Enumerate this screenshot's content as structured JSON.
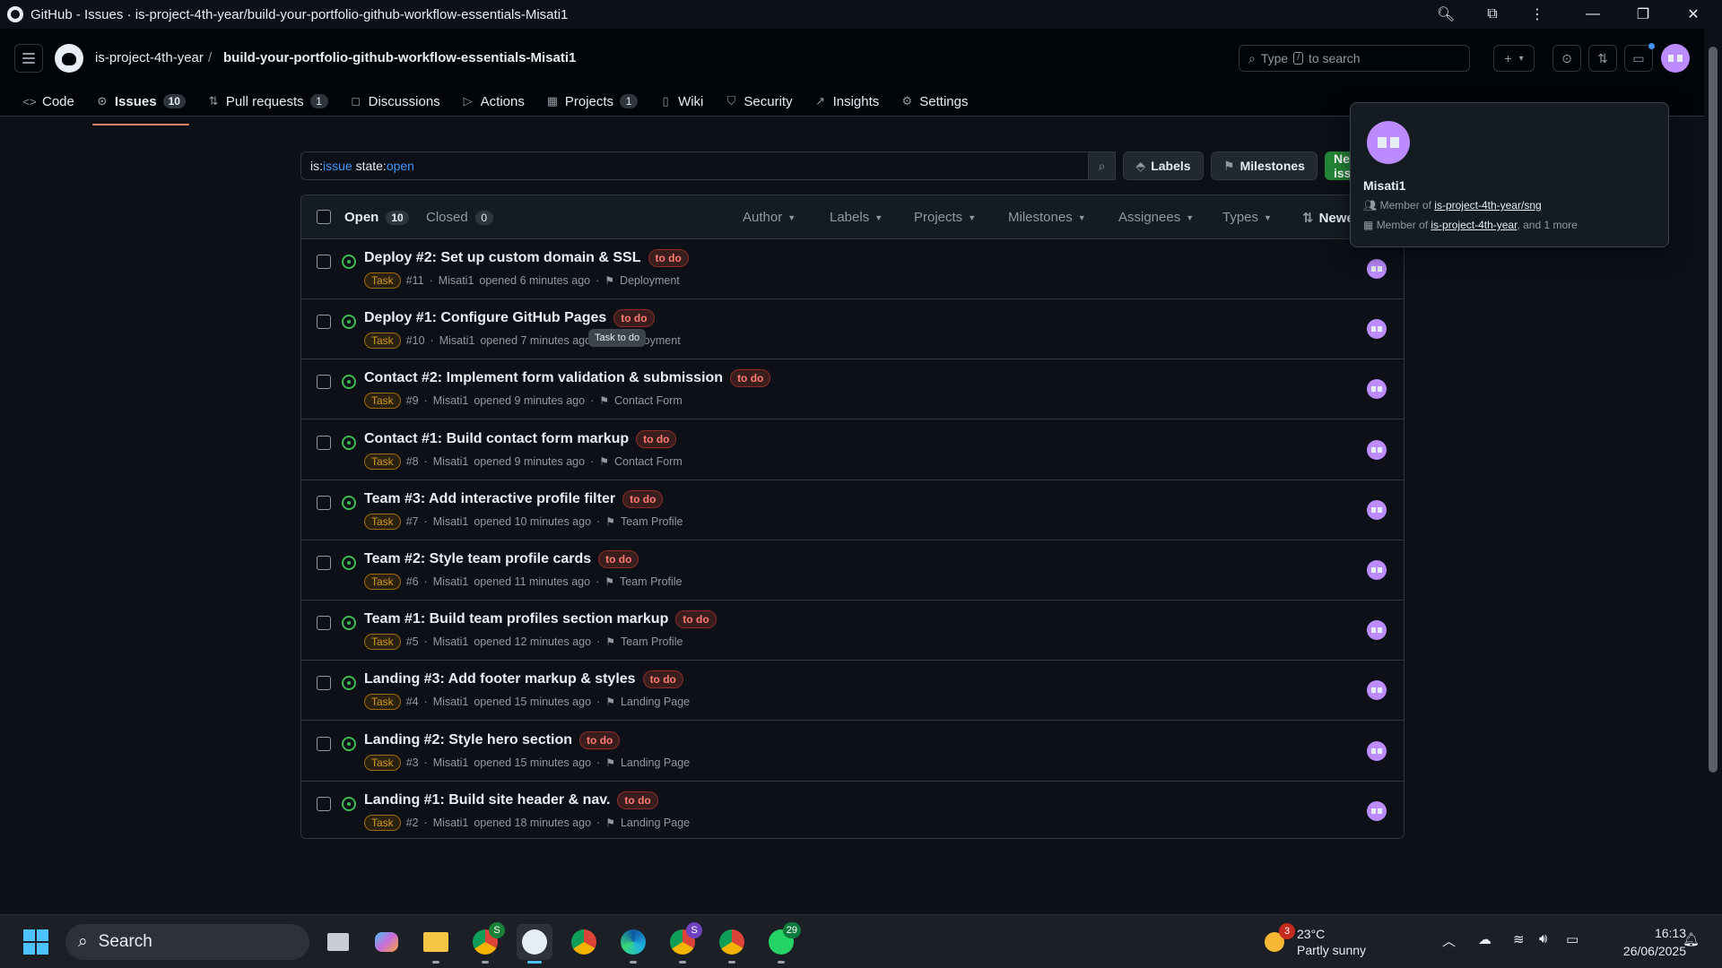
{
  "window": {
    "title": "GitHub - Issues · is-project-4th-year/build-your-portfolio-github-workflow-essentials-Misati1"
  },
  "header": {
    "owner": "is-project-4th-year",
    "separator": "/",
    "repo": "build-your-portfolio-github-workflow-essentials-Misati1",
    "search_prefix": "Type",
    "search_key": "/",
    "search_suffix": "to search",
    "plus_label": "+",
    "caret": "▾"
  },
  "repo_nav": [
    {
      "label": "Code",
      "icon": "code-icon",
      "glyph": "<>",
      "count": ""
    },
    {
      "label": "Issues",
      "icon": "issue-icon",
      "glyph": "⊙",
      "count": "10",
      "active": true
    },
    {
      "label": "Pull requests",
      "icon": "pull-request-icon",
      "glyph": "⇅",
      "count": "1"
    },
    {
      "label": "Discussions",
      "icon": "discussions-icon",
      "glyph": "◻",
      "count": ""
    },
    {
      "label": "Actions",
      "icon": "actions-icon",
      "glyph": "▷",
      "count": ""
    },
    {
      "label": "Projects",
      "icon": "projects-icon",
      "glyph": "▦",
      "count": "1"
    },
    {
      "label": "Wiki",
      "icon": "book-icon",
      "glyph": "▯",
      "count": ""
    },
    {
      "label": "Security",
      "icon": "shield-icon",
      "glyph": "⛉",
      "count": ""
    },
    {
      "label": "Insights",
      "icon": "graph-icon",
      "glyph": "↗",
      "count": ""
    },
    {
      "label": "Settings",
      "icon": "gear-icon",
      "glyph": "⚙",
      "count": ""
    }
  ],
  "filter": {
    "k1": "is:",
    "v1": "issue",
    "k2": " state:",
    "v2": "open"
  },
  "buttons": {
    "labels": "Labels",
    "milestones": "Milestones",
    "new_issue": "New issue"
  },
  "list_header": {
    "open_label": "Open",
    "open_count": "10",
    "closed_label": "Closed",
    "closed_count": "0",
    "filters": [
      "Author",
      "Labels",
      "Projects",
      "Milestones",
      "Assignees",
      "Types"
    ],
    "sort": "Newest"
  },
  "issues": [
    {
      "title": "Deploy #2: Set up custom domain & SSL",
      "label": "to do",
      "type": "Task",
      "number": "#11",
      "author": "Misati1",
      "opened": "opened 6 minutes ago",
      "milestone": "Deployment"
    },
    {
      "title": "Deploy #1: Configure GitHub Pages",
      "label": "to do",
      "type": "Task",
      "number": "#10",
      "author": "Misati1",
      "opened": "opened 7 minutes ago",
      "milestone": "Deployment"
    },
    {
      "title": "Contact #2: Implement form validation & submission",
      "label": "to do",
      "type": "Task",
      "number": "#9",
      "author": "Misati1",
      "opened": "opened 9 minutes ago",
      "milestone": "Contact Form"
    },
    {
      "title": "Contact #1: Build contact form markup",
      "label": "to do",
      "type": "Task",
      "number": "#8",
      "author": "Misati1",
      "opened": "opened 9 minutes ago",
      "milestone": "Contact Form"
    },
    {
      "title": "Team #3: Add interactive profile filter",
      "label": "to do",
      "type": "Task",
      "number": "#7",
      "author": "Misati1",
      "opened": "opened 10 minutes ago",
      "milestone": "Team Profile"
    },
    {
      "title": "Team #2: Style team profile cards",
      "label": "to do",
      "type": "Task",
      "number": "#6",
      "author": "Misati1",
      "opened": "opened 11 minutes ago",
      "milestone": "Team Profile"
    },
    {
      "title": "Team #1: Build team profiles section markup",
      "label": "to do",
      "type": "Task",
      "number": "#5",
      "author": "Misati1",
      "opened": "opened 12 minutes ago",
      "milestone": "Team Profile"
    },
    {
      "title": "Landing #3: Add footer markup & styles",
      "label": "to do",
      "type": "Task",
      "number": "#4",
      "author": "Misati1",
      "opened": "opened 15 minutes ago",
      "milestone": "Landing Page"
    },
    {
      "title": "Landing #2: Style hero section",
      "label": "to do",
      "type": "Task",
      "number": "#3",
      "author": "Misati1",
      "opened": "opened 15 minutes ago",
      "milestone": "Landing Page"
    },
    {
      "title": "Landing #1: Build site header & nav.",
      "label": "to do",
      "type": "Task",
      "number": "#2",
      "author": "Misati1",
      "opened": "opened 18 minutes ago",
      "milestone": "Landing Page"
    }
  ],
  "tooltip": "Task to do",
  "hovercard": {
    "name": "Misati1",
    "member_prefix": "Member of",
    "team": "is-project-4th-year/sng",
    "org": "is-project-4th-year",
    "more": ", and 1 more"
  },
  "taskbar": {
    "search": "Search",
    "chrome_badge_1": "S",
    "chrome_badge_2": "S",
    "whatsapp_badge": "29",
    "weather_badge": "3",
    "temp": "23°C",
    "condition": "Partly sunny",
    "time": "16:13",
    "date": "26/06/2025"
  },
  "colors": {
    "accent_green": "#3fb950",
    "nav_underline": "#f78166",
    "label_todo": "#ff7b72",
    "type_task": "#d29922"
  }
}
